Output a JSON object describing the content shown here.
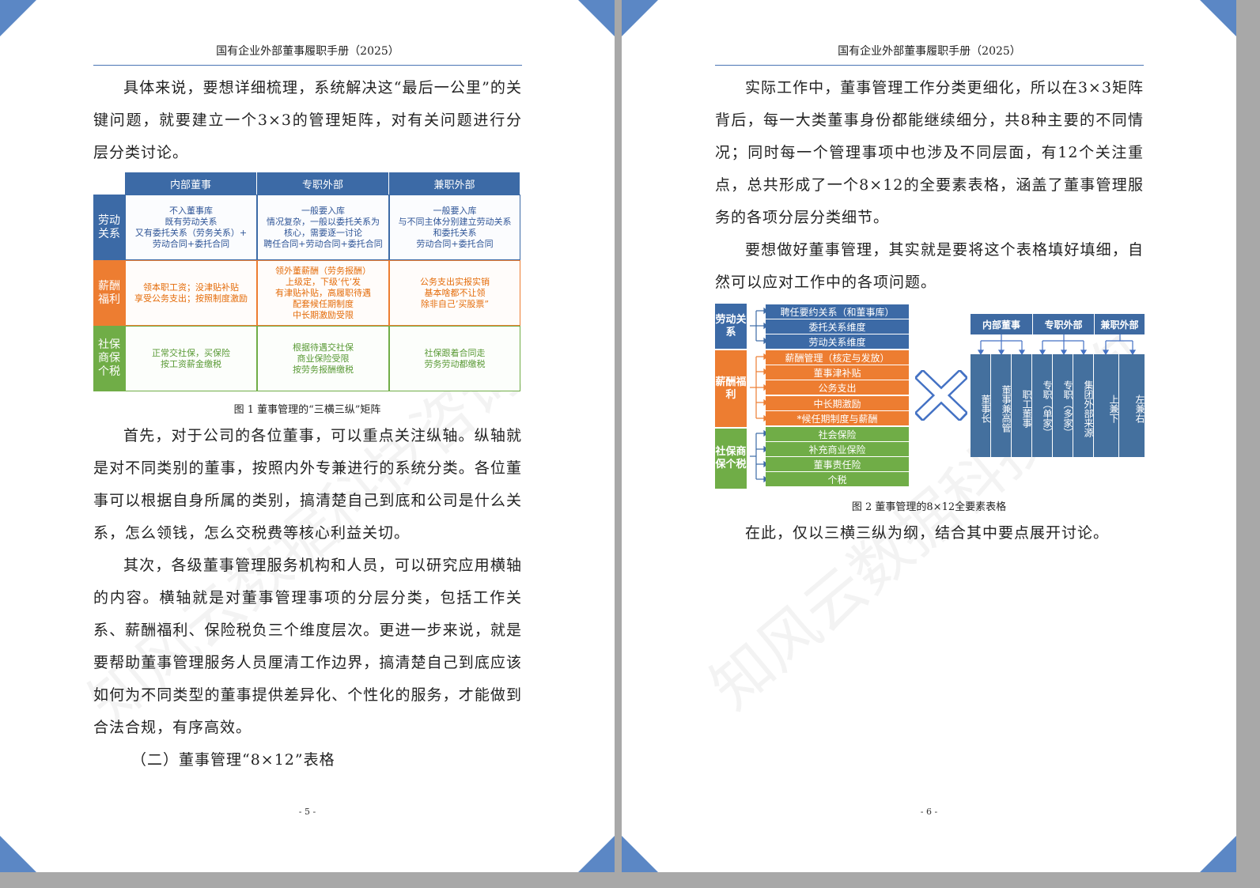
{
  "header_title": "国有企业外部董事履职手册（2025）",
  "left_page": {
    "para1": "具体来说，要想详细梳理，系统解决这“最后一公里”的关键问题，就要建立一个3×3的管理矩阵，对有关问题进行分层分类讨论。",
    "figure1": {
      "columns": [
        "内部董事",
        "专职外部",
        "兼职外部"
      ],
      "rows": [
        {
          "label": "劳动关系",
          "cells": [
            "不入董事库\n既有劳动关系\n又有委托关系（劳务关系）+\n劳动合同+委托合同",
            "一般要入库\n情况复杂，一般以委托关系为\n核心，需要逐一讨论\n聘任合同+劳动合同+委托合同",
            "一般要入库\n与不同主体分别建立劳动关系\n和委托关系\n劳动合同+委托合同"
          ]
        },
        {
          "label": "薪酬福利",
          "cells": [
            "领本职工资；没津贴补贴\n享受公务支出；按照制度激励",
            "领外董薪酬（劳务报酬）\n上级定，下级‘代’发\n有津贴补贴，高履职待遇\n配套候任期制度\n中长期激励受限",
            "公务支出实报实销\n基本啥都不让领\n除非自己’买股票”"
          ]
        },
        {
          "label": "社保商保个税",
          "cells": [
            "正常交社保，买保险\n按工资薪金缴税",
            "根据待遇交社保\n商业保险受限\n按劳务报酬缴税",
            "社保跟着合同走\n劳务劳动都缴税"
          ]
        }
      ],
      "caption": "图 1 董事管理的“三横三纵”矩阵"
    },
    "para2": "首先，对于公司的各位董事，可以重点关注纵轴。纵轴就是对不同类别的董事，按照内外专兼进行的系统分类。各位董事可以根据自身所属的类别，搞清楚自己到底和公司是什么关系，怎么领钱，怎么交税费等核心利益关切。",
    "para3": "其次，各级董事管理服务机构和人员，可以研究应用横轴的内容。横轴就是对董事管理事项的分层分类，包括工作关系、薪酬福利、保险税负三个维度层次。更进一步来说，就是要帮助董事管理服务人员厘清工作边界，搞清楚自己到底应该如何为不同类型的董事提供差异化、个性化的服务，才能做到合法合规，有序高效。",
    "para4": "（二）董事管理“8×12”表格",
    "page_number": "- 5 -"
  },
  "right_page": {
    "para1": "实际工作中，董事管理工作分类更细化，所以在3×3矩阵背后，每一大类董事身份都能继续细分，共8种主要的不同情况；同时每一个管理事项中也涉及不同层面，有12个关注重点，总共形成了一个8×12的全要素表格，涵盖了董事管理服务的各项分层分类细节。",
    "para2": "要想做好董事管理，其实就是要将这个表格填好填细，自然可以应对工作中的各项问题。",
    "figure2": {
      "groups": [
        {
          "label": "劳动关系",
          "items": [
            "聘任要约关系（和董事库）",
            "委托关系维度",
            "劳动关系维度"
          ]
        },
        {
          "label": "薪酬福利",
          "items": [
            "薪酬管理（核定与发放）",
            "董事津补贴",
            "公务支出",
            "中长期激励",
            "*候任期制度与薪酬"
          ]
        },
        {
          "label": "社保商保个税",
          "items": [
            "社会保险",
            "补充商业保险",
            "董事责任险",
            "个税"
          ]
        }
      ],
      "column_headers": [
        "内部董事",
        "专职外部",
        "兼职外部"
      ],
      "subcolumns": [
        "董事长",
        "董事兼高管",
        "职工董事",
        "专职（单家）",
        "专职（多家）",
        "集团外部来源",
        "上兼下",
        "左兼右"
      ],
      "caption": "图 2 董事管理的8×12全要素表格"
    },
    "para3": "在此，仅以三横三纵为纲，结合其中要点展开讨论。",
    "page_number": "- 6 -"
  },
  "watermark": "知风云数据科技咨询",
  "colors": {
    "blue": "#3c6aa6",
    "orange": "#ed7d31",
    "green": "#70ad47",
    "corner": "#5b87c5"
  }
}
